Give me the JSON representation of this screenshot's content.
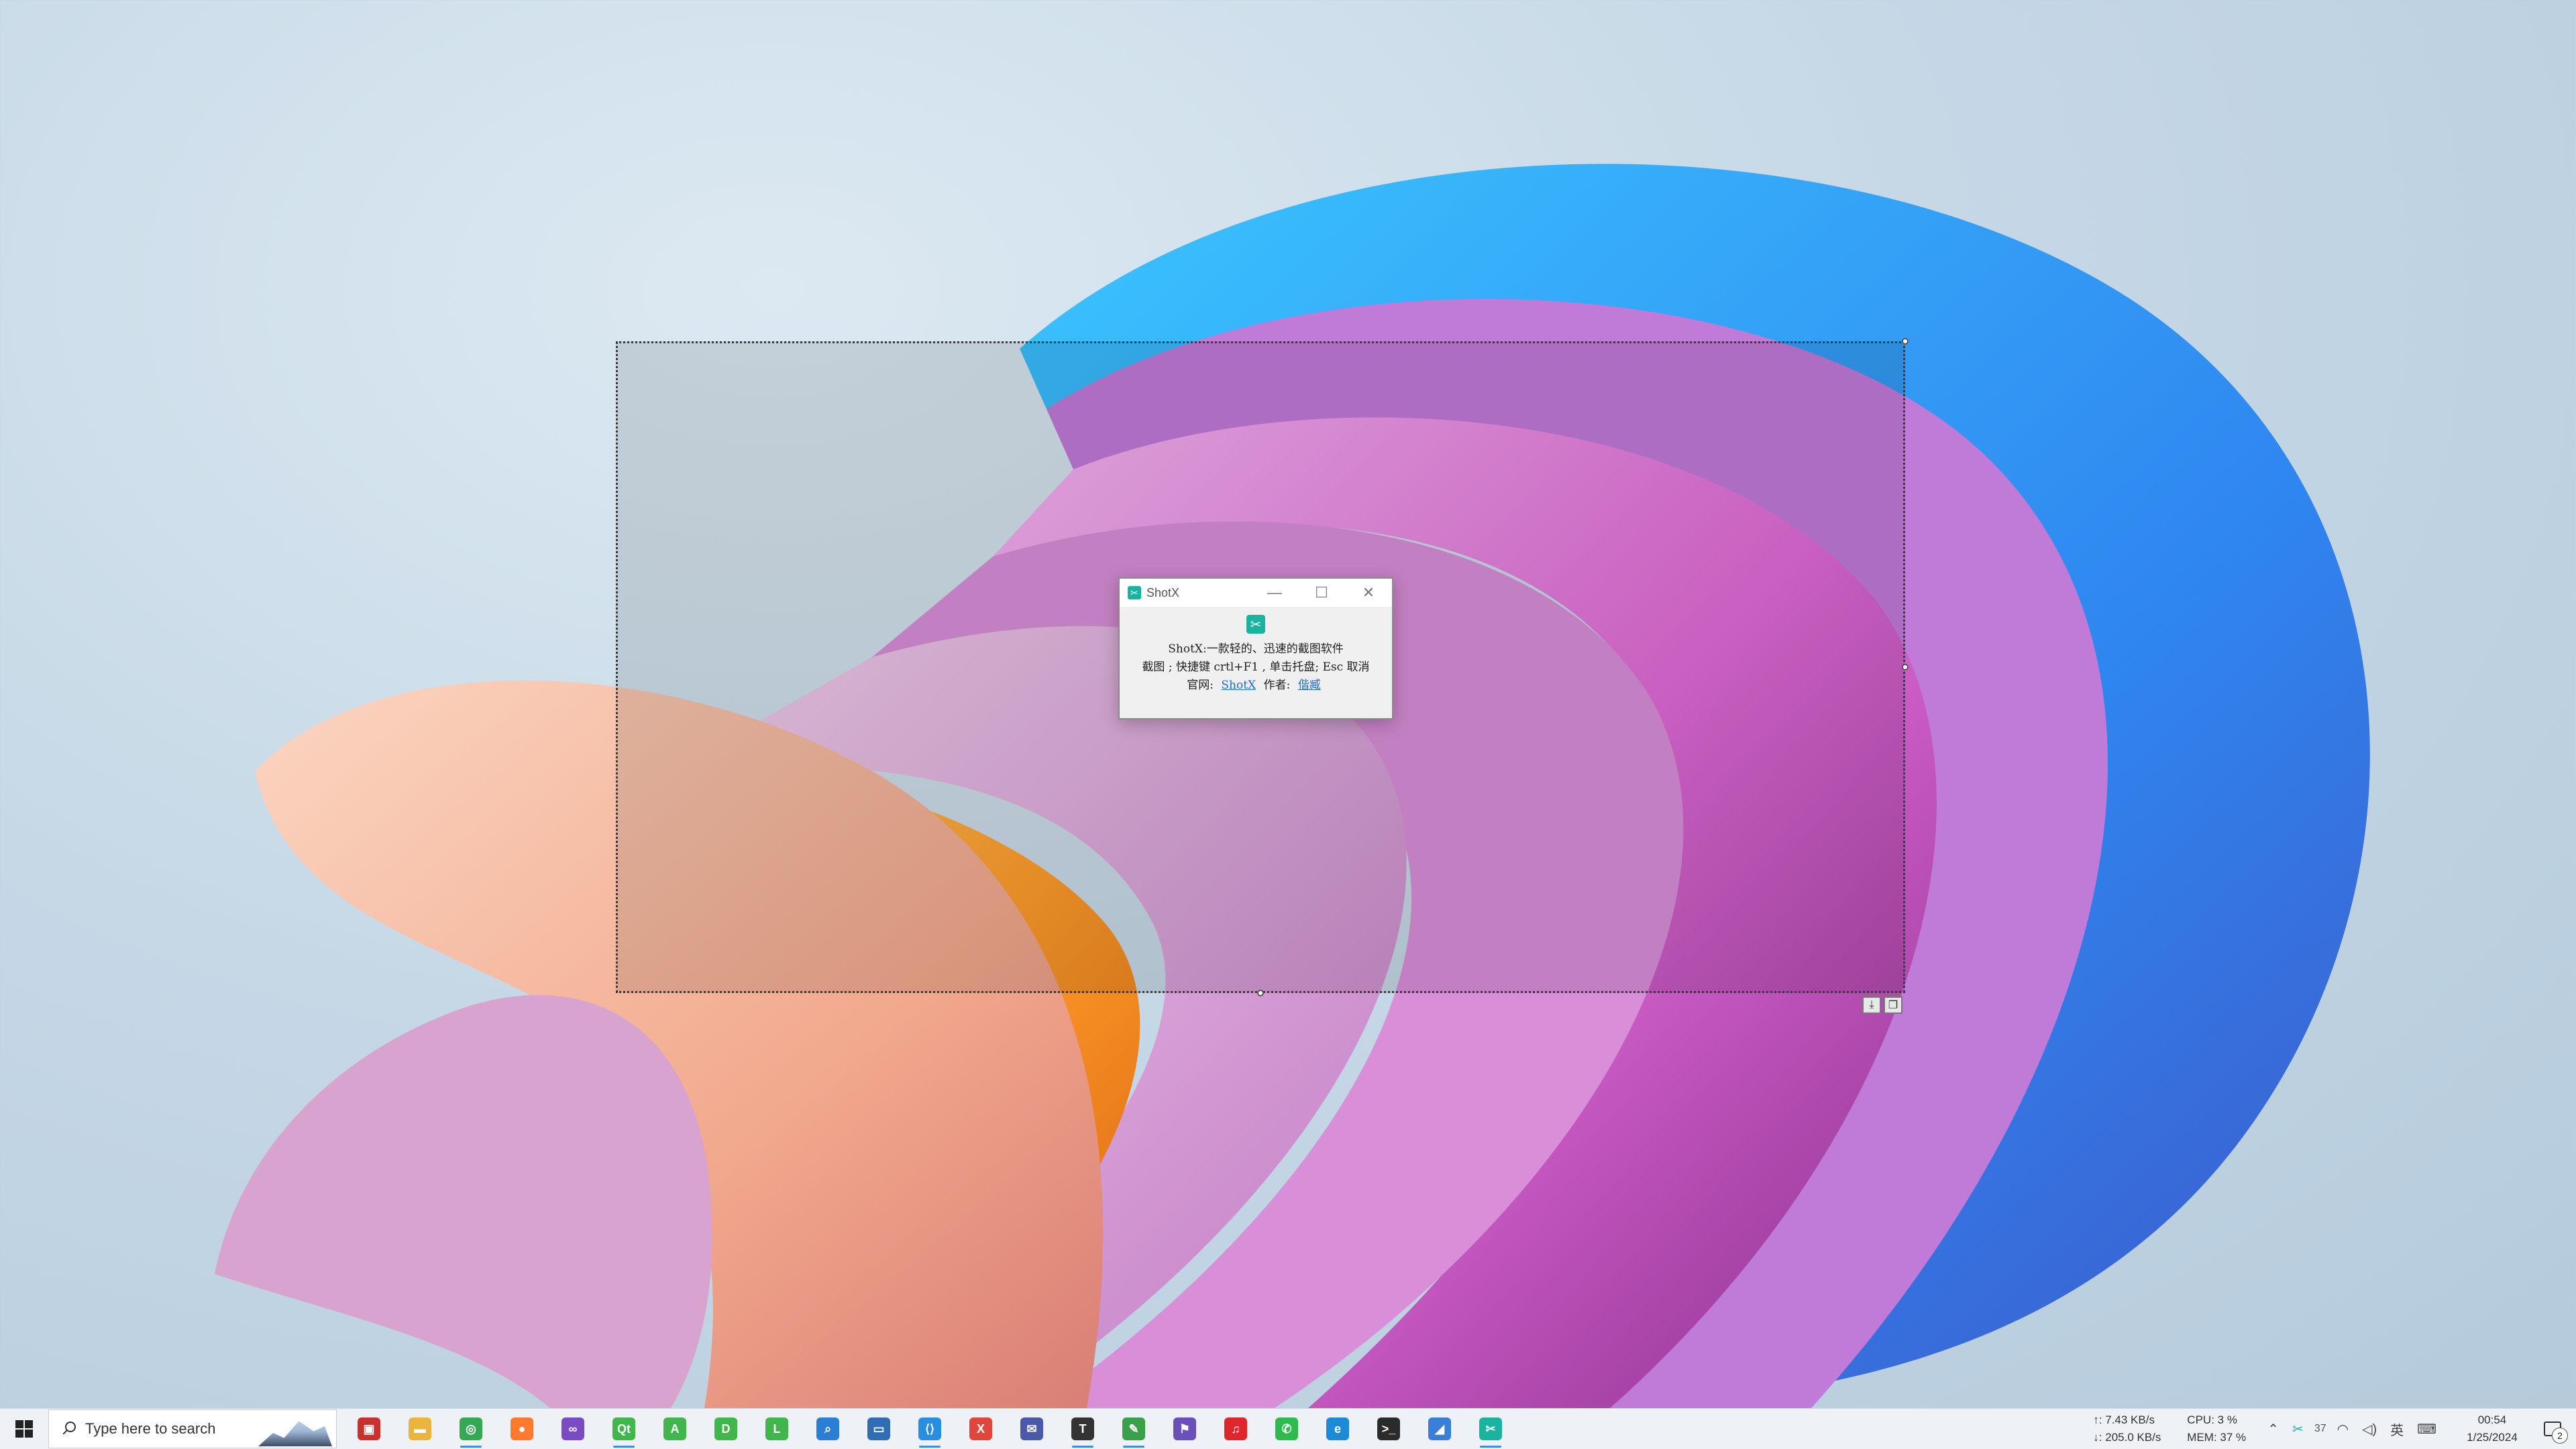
{
  "dialog": {
    "title": "ShotX",
    "minimize_glyph": "—",
    "maximize_glyph": "☐",
    "close_glyph": "✕",
    "line1": "ShotX:一款轻的、迅速的截图软件",
    "line2": "截图 ; 快捷键 crtl+F1 , 单击托盘; Esc 取消",
    "line3_prefix": "官网:",
    "site_link": "ShotX",
    "author_label": "作者:",
    "author_link": "偕臧"
  },
  "taskbar": {
    "search_placeholder": "Type here to search",
    "apps": [
      {
        "icon": "scan-app-icon",
        "color": "#c8322c",
        "glyph": "▣",
        "running": false
      },
      {
        "icon": "file-explorer-icon",
        "color": "#e9b53d",
        "glyph": "▬",
        "running": false
      },
      {
        "icon": "chrome-icon",
        "color": "#35a853",
        "glyph": "◎",
        "running": true
      },
      {
        "icon": "firefox-icon",
        "color": "#ff7a2f",
        "glyph": "●",
        "running": false
      },
      {
        "icon": "visual-studio-icon",
        "color": "#7a4bc4",
        "glyph": "∞",
        "running": false
      },
      {
        "icon": "qt-creator-icon",
        "color": "#41b64a",
        "glyph": "Qt",
        "running": true
      },
      {
        "icon": "qt-assistant-icon",
        "color": "#41b64a",
        "glyph": "A",
        "running": false
      },
      {
        "icon": "qt-designer-icon",
        "color": "#41b64a",
        "glyph": "D",
        "running": false
      },
      {
        "icon": "qt-linguist-icon",
        "color": "#41b64a",
        "glyph": "L",
        "running": false
      },
      {
        "icon": "search-tool-icon",
        "color": "#2a7fd4",
        "glyph": "⌕",
        "running": false
      },
      {
        "icon": "remote-desktop-icon",
        "color": "#2f6db5",
        "glyph": "▭",
        "running": false
      },
      {
        "icon": "vscode-icon",
        "color": "#2a8ee0",
        "glyph": "⟨⟩",
        "running": true
      },
      {
        "icon": "xmind-icon",
        "color": "#e0463a",
        "glyph": "X",
        "running": false
      },
      {
        "icon": "chat-app-icon",
        "color": "#4a5aa8",
        "glyph": "✉",
        "running": false
      },
      {
        "icon": "typora-icon",
        "color": "#333333",
        "glyph": "T",
        "running": true
      },
      {
        "icon": "notepad-icon",
        "color": "#3aa04a",
        "glyph": "✎",
        "running": true
      },
      {
        "icon": "github-desktop-icon",
        "color": "#6b4fbb",
        "glyph": "⚑",
        "running": false
      },
      {
        "icon": "netease-music-icon",
        "color": "#e0252b",
        "glyph": "♫",
        "running": false
      },
      {
        "icon": "wechat-icon",
        "color": "#2dbb4e",
        "glyph": "✆",
        "running": false
      },
      {
        "icon": "edge-icon",
        "color": "#1e8ad6",
        "glyph": "e",
        "running": false
      },
      {
        "icon": "terminal-icon",
        "color": "#2b2b2b",
        "glyph": ">_",
        "running": false
      },
      {
        "icon": "paint-icon",
        "color": "#3b7ed6",
        "glyph": "◢",
        "running": false
      },
      {
        "icon": "shotx-icon",
        "color": "#19b3a0",
        "glyph": "✂",
        "running": true
      }
    ],
    "net_up": "↑: 7.43 KB/s",
    "net_down": "↓: 205.0 KB/s",
    "cpu": "CPU: 3 %",
    "mem": "MEM: 37 %",
    "tray_count": "37",
    "ime": "英",
    "time": "00:54",
    "date": "1/25/2024",
    "notification_count": "2"
  }
}
